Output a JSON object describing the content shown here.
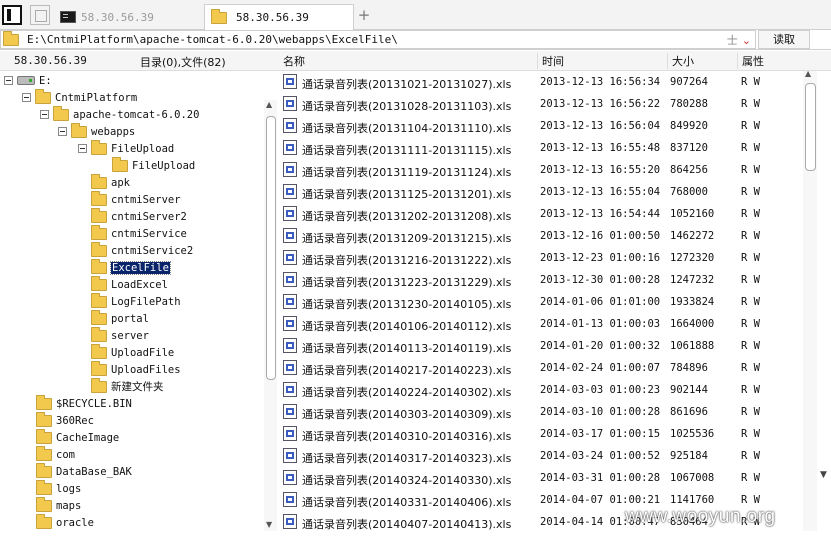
{
  "tabs": [
    {
      "label": "58.30.56.39",
      "icon": "terminal-icon",
      "active": false
    },
    {
      "label": "58.30.56.39",
      "icon": "folder-icon",
      "active": true
    }
  ],
  "address": {
    "path": "E:\\CntmiPlatform\\apache-tomcat-6.0.20\\webapps\\ExcelFile\\",
    "extra": "士",
    "read_label": "读取"
  },
  "left_header": {
    "host": "58.30.56.39",
    "count": "目录(0),文件(82)"
  },
  "tree": [
    {
      "label": "E:",
      "type": "drive",
      "depth": 0,
      "expanded": true
    },
    {
      "label": "CntmiPlatform",
      "type": "folder",
      "depth": 1,
      "expanded": true
    },
    {
      "label": "apache-tomcat-6.0.20",
      "type": "folder",
      "depth": 2,
      "expanded": true
    },
    {
      "label": "webapps",
      "type": "folder",
      "depth": 3,
      "expanded": true
    },
    {
      "label": "FileUpload",
      "type": "folder",
      "depth": 4,
      "expanded": true
    },
    {
      "label": "FileUpload",
      "type": "folder",
      "depth": 5,
      "expanded": false
    },
    {
      "label": "apk",
      "type": "folder",
      "depth": 4,
      "expanded": false
    },
    {
      "label": "cntmiServer",
      "type": "folder",
      "depth": 4,
      "expanded": false
    },
    {
      "label": "cntmiServer2",
      "type": "folder",
      "depth": 4,
      "expanded": false
    },
    {
      "label": "cntmiService",
      "type": "folder",
      "depth": 4,
      "expanded": false
    },
    {
      "label": "cntmiService2",
      "type": "folder",
      "depth": 4,
      "expanded": false
    },
    {
      "label": "ExcelFile",
      "type": "folder",
      "depth": 4,
      "expanded": false,
      "selected": true
    },
    {
      "label": "LoadExcel",
      "type": "folder",
      "depth": 4,
      "expanded": false
    },
    {
      "label": "LogFilePath",
      "type": "folder",
      "depth": 4,
      "expanded": false
    },
    {
      "label": "portal",
      "type": "folder",
      "depth": 4,
      "expanded": false
    },
    {
      "label": "server",
      "type": "folder",
      "depth": 4,
      "expanded": false
    },
    {
      "label": "UploadFile",
      "type": "folder",
      "depth": 4,
      "expanded": false
    },
    {
      "label": "UploadFiles",
      "type": "folder",
      "depth": 4,
      "expanded": false
    },
    {
      "label": "新建文件夹",
      "type": "folder",
      "depth": 4,
      "expanded": false
    },
    {
      "label": "$RECYCLE.BIN",
      "type": "folder",
      "depth": 1,
      "expanded": false
    },
    {
      "label": "360Rec",
      "type": "folder",
      "depth": 1,
      "expanded": false
    },
    {
      "label": "CacheImage",
      "type": "folder",
      "depth": 1,
      "expanded": false
    },
    {
      "label": "com",
      "type": "folder",
      "depth": 1,
      "expanded": false
    },
    {
      "label": "DataBase_BAK",
      "type": "folder",
      "depth": 1,
      "expanded": false
    },
    {
      "label": "logs",
      "type": "folder",
      "depth": 1,
      "expanded": false
    },
    {
      "label": "maps",
      "type": "folder",
      "depth": 1,
      "expanded": false
    },
    {
      "label": "oracle",
      "type": "folder",
      "depth": 1,
      "expanded": false
    }
  ],
  "columns": {
    "name": "名称",
    "date": "时间",
    "size": "大小",
    "attr": "属性"
  },
  "files": [
    {
      "name": "通话录音列表(20131021-20131027).xls",
      "date": "2013-12-13 16:56:34",
      "size": "907264",
      "attr": "R W"
    },
    {
      "name": "通话录音列表(20131028-20131103).xls",
      "date": "2013-12-13 16:56:22",
      "size": "780288",
      "attr": "R W"
    },
    {
      "name": "通话录音列表(20131104-20131110).xls",
      "date": "2013-12-13 16:56:04",
      "size": "849920",
      "attr": "R W"
    },
    {
      "name": "通话录音列表(20131111-20131115).xls",
      "date": "2013-12-13 16:55:48",
      "size": "837120",
      "attr": "R W"
    },
    {
      "name": "通话录音列表(20131119-20131124).xls",
      "date": "2013-12-13 16:55:20",
      "size": "864256",
      "attr": "R W"
    },
    {
      "name": "通话录音列表(20131125-20131201).xls",
      "date": "2013-12-13 16:55:04",
      "size": "768000",
      "attr": "R W"
    },
    {
      "name": "通话录音列表(20131202-20131208).xls",
      "date": "2013-12-13 16:54:44",
      "size": "1052160",
      "attr": "R W"
    },
    {
      "name": "通话录音列表(20131209-20131215).xls",
      "date": "2013-12-16 01:00:50",
      "size": "1462272",
      "attr": "R W"
    },
    {
      "name": "通话录音列表(20131216-20131222).xls",
      "date": "2013-12-23 01:00:16",
      "size": "1272320",
      "attr": "R W"
    },
    {
      "name": "通话录音列表(20131223-20131229).xls",
      "date": "2013-12-30 01:00:28",
      "size": "1247232",
      "attr": "R W"
    },
    {
      "name": "通话录音列表(20131230-20140105).xls",
      "date": "2014-01-06 01:01:00",
      "size": "1933824",
      "attr": "R W"
    },
    {
      "name": "通话录音列表(20140106-20140112).xls",
      "date": "2014-01-13 01:00:03",
      "size": "1664000",
      "attr": "R W"
    },
    {
      "name": "通话录音列表(20140113-20140119).xls",
      "date": "2014-01-20 01:00:32",
      "size": "1061888",
      "attr": "R W"
    },
    {
      "name": "通话录音列表(20140217-20140223).xls",
      "date": "2014-02-24 01:00:07",
      "size": "784896",
      "attr": "R W"
    },
    {
      "name": "通话录音列表(20140224-20140302).xls",
      "date": "2014-03-03 01:00:23",
      "size": "902144",
      "attr": "R W"
    },
    {
      "name": "通话录音列表(20140303-20140309).xls",
      "date": "2014-03-10 01:00:28",
      "size": "861696",
      "attr": "R W"
    },
    {
      "name": "通话录音列表(20140310-20140316).xls",
      "date": "2014-03-17 01:00:15",
      "size": "1025536",
      "attr": "R W"
    },
    {
      "name": "通话录音列表(20140317-20140323).xls",
      "date": "2014-03-24 01:00:52",
      "size": "925184",
      "attr": "R W"
    },
    {
      "name": "通话录音列表(20140324-20140330).xls",
      "date": "2014-03-31 01:00:28",
      "size": "1067008",
      "attr": "R W"
    },
    {
      "name": "通话录音列表(20140331-20140406).xls",
      "date": "2014-04-07 01:00:21",
      "size": "1141760",
      "attr": "R W"
    },
    {
      "name": "通话录音列表(20140407-20140413).xls",
      "date": "2014-04-14 01:00:47",
      "size": "830464",
      "attr": "R W"
    }
  ],
  "watermark": "www.wooyun.org"
}
